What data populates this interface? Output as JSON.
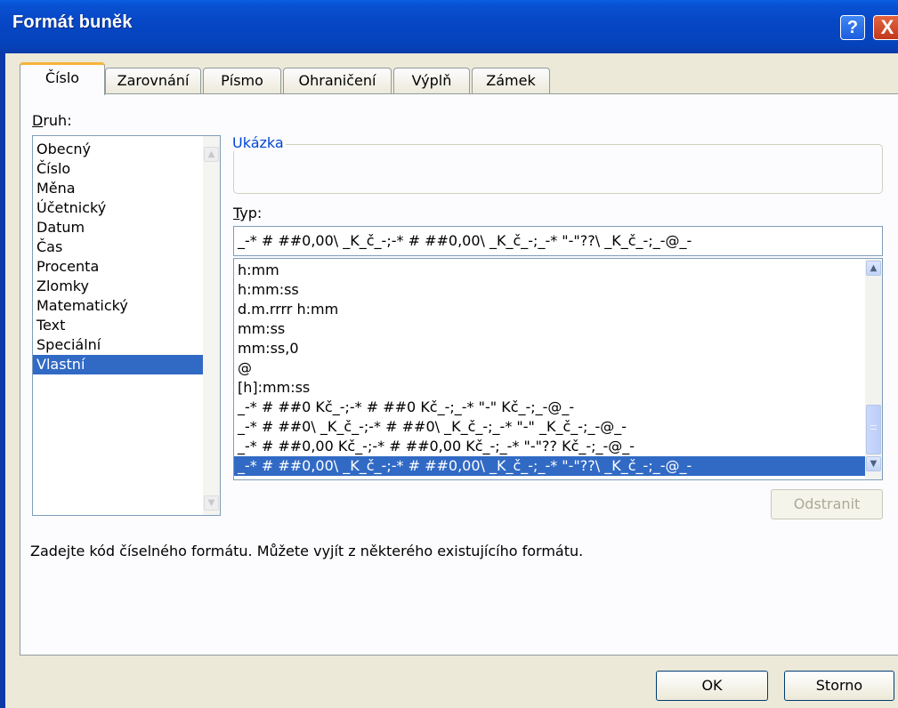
{
  "title": "Formát buněk",
  "title_buttons": {
    "help": "?",
    "close": "X"
  },
  "tabs": [
    "Číslo",
    "Zarovnání",
    "Písmo",
    "Ohraničení",
    "Výplň",
    "Zámek"
  ],
  "category": {
    "label": "Druh:",
    "items": [
      "Obecný",
      "Číslo",
      "Měna",
      "Účetnický",
      "Datum",
      "Čas",
      "Procenta",
      "Zlomky",
      "Matematický",
      "Text",
      "Speciální",
      "Vlastní"
    ],
    "selected": "Vlastní"
  },
  "sample": {
    "label": "Ukázka",
    "value": ""
  },
  "type": {
    "label": "Typ:",
    "value": "_-* # ##0,00\\ _K_č_-;-* # ##0,00\\ _K_č_-;_-* \"-\"??\\ _K_č_-;_-@_-"
  },
  "format_list": [
    "h:mm",
    "h:mm:ss",
    "d.m.rrrr h:mm",
    "mm:ss",
    "mm:ss,0",
    "@",
    "[h]:mm:ss",
    "_-* # ##0 Kč_-;-* # ##0 Kč_-;_-* \"-\" Kč_-;_-@_-",
    "_-* # ##0\\ _K_č_-;-* # ##0\\ _K_č_-;_-* \"-\" _K_č_-;_-@_-",
    "_-* # ##0,00 Kč_-;-* # ##0,00 Kč_-;_-* \"-\"?? Kč_-;_-@_-",
    "_-* # ##0,00\\ _K_č_-;-* # ##0,00\\ _K_č_-;_-* \"-\"??\\ _K_č_-;_-@_-"
  ],
  "format_selected_index": 10,
  "delete_button": "Odstranit",
  "description": "Zadejte kód číselného formátu. Můžete vyjít z některého existujícího formátu.",
  "ok_button": "OK",
  "cancel_button": "Storno"
}
